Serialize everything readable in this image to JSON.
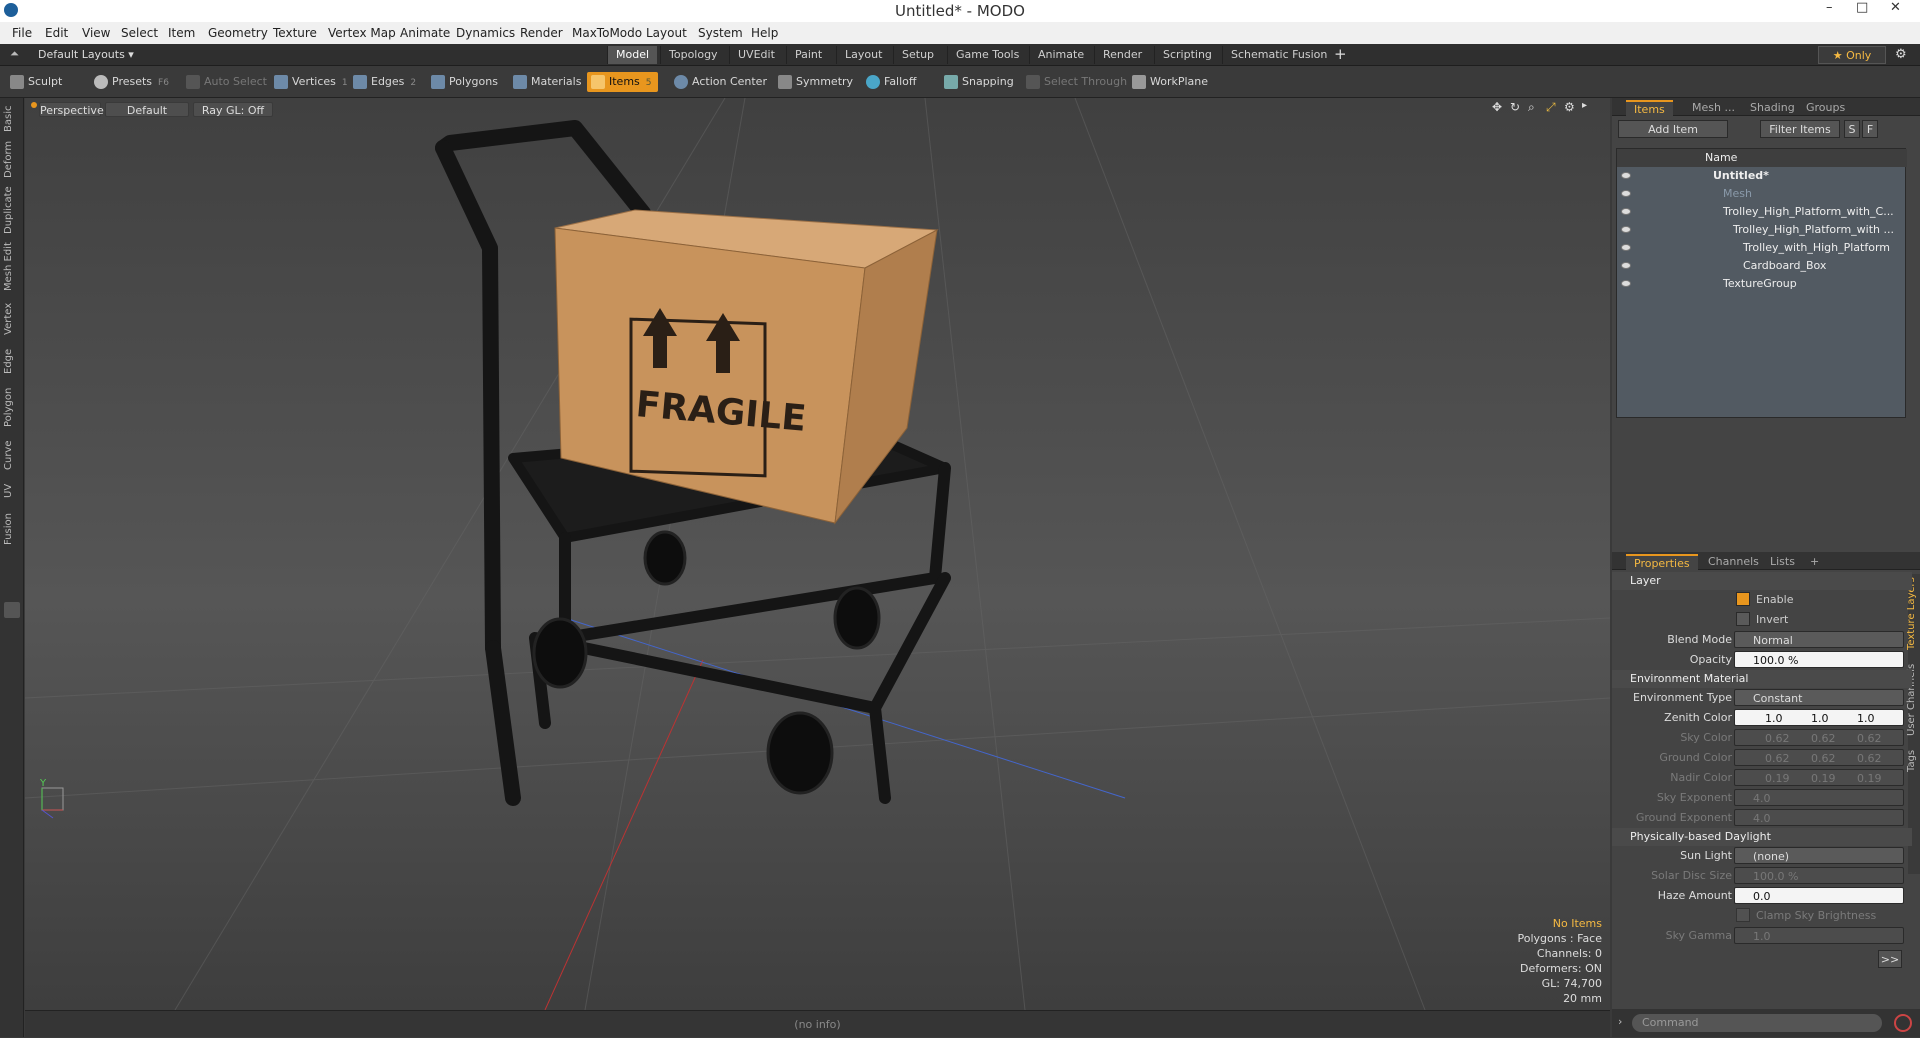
{
  "window": {
    "title": "Untitled* - MODO",
    "controls": [
      "–",
      "□",
      "✕"
    ]
  },
  "menu": [
    "File",
    "Edit",
    "View",
    "Select",
    "Item",
    "Geometry",
    "Texture",
    "Vertex Map",
    "Animate",
    "Dynamics",
    "Render",
    "MaxToModo",
    "Layout",
    "System",
    "Help"
  ],
  "layouts": {
    "label": "Default Layouts ▾",
    "tabs": [
      "Model",
      "Topology",
      "UVEdit",
      "Paint",
      "Layout",
      "Setup",
      "Game Tools",
      "Animate",
      "Render",
      "Scripting",
      "Schematic Fusion"
    ],
    "active": "Model",
    "add": "+",
    "only": "★ Only"
  },
  "toolbar": {
    "sculpt": "Sculpt",
    "presets": "Presets",
    "presets_key": "F6",
    "auto_select": "Auto Select",
    "vertices": "Vertices",
    "vertices_n": "1",
    "edges": "Edges",
    "edges_n": "2",
    "polygons": "Polygons",
    "materials": "Materials",
    "items": "Items",
    "items_n": "5",
    "action_center": "Action Center",
    "symmetry": "Symmetry",
    "falloff": "Falloff",
    "snapping": "Snapping",
    "select_through": "Select Through",
    "workplane": "WorkPlane"
  },
  "left_tabs": [
    "Basic",
    "Deform",
    "Duplicate",
    "Mesh Edit",
    "Vertex",
    "Edge",
    "Polygon",
    "Curve",
    "UV",
    "Fusion"
  ],
  "viewport": {
    "view": "Perspective",
    "shading": "Default",
    "raygl": "Ray GL: Off",
    "box_label": "FRAGILE",
    "status": {
      "no_items": "No Items",
      "polygons": "Polygons : Face",
      "channels": "Channels: 0",
      "deformers": "Deformers: ON",
      "gl": "GL: 74,700",
      "scale": "20 mm"
    },
    "axis_y": "Y",
    "info": "(no info)"
  },
  "items_panel": {
    "tabs": [
      "Items",
      "Mesh ...",
      "Shading",
      "Groups"
    ],
    "add_item": "Add Item",
    "filter": "Filter Items",
    "s": "S",
    "f": "F",
    "col_name": "Name",
    "rows": [
      {
        "name": "Untitled*",
        "bold": true,
        "indent": 0
      },
      {
        "name": "Mesh",
        "dim": true,
        "indent": 1
      },
      {
        "name": "Trolley_High_Platform_with_C...",
        "indent": 1
      },
      {
        "name": "Trolley_High_Platform_with ...",
        "indent": 2
      },
      {
        "name": "Trolley_with_High_Platform",
        "indent": 3
      },
      {
        "name": "Cardboard_Box",
        "indent": 3
      },
      {
        "name": "TextureGroup",
        "indent": 1
      }
    ]
  },
  "props_panel": {
    "tabs": [
      "Properties",
      "Channels",
      "Lists",
      "+"
    ],
    "side_tabs": [
      "Texture Layers",
      "User Channels",
      "Tags"
    ],
    "layer": "Layer",
    "enable": "Enable",
    "invert": "Invert",
    "blend_mode_label": "Blend Mode",
    "blend_mode": "Normal",
    "opacity_label": "Opacity",
    "opacity": "100.0 %",
    "env_material": "Environment Material",
    "env_type_label": "Environment Type",
    "env_type": "Constant",
    "zenith_label": "Zenith Color",
    "zenith": [
      "1.0",
      "1.0",
      "1.0"
    ],
    "sky_label": "Sky Color",
    "sky": [
      "0.62",
      "0.62",
      "0.62"
    ],
    "ground_label": "Ground Color",
    "ground": [
      "0.62",
      "0.62",
      "0.62"
    ],
    "nadir_label": "Nadir Color",
    "nadir": [
      "0.19",
      "0.19",
      "0.19"
    ],
    "sky_exp_label": "Sky Exponent",
    "sky_exp": "4.0",
    "ground_exp_label": "Ground Exponent",
    "ground_exp": "4.0",
    "daylight": "Physically-based Daylight",
    "sun_label": "Sun Light",
    "sun": "(none)",
    "solar_label": "Solar Disc Size",
    "solar": "100.0 %",
    "haze_label": "Haze Amount",
    "haze": "0.0",
    "clamp": "Clamp Sky Brightness",
    "gamma_label": "Sky Gamma",
    "gamma": "1.0",
    "more": ">>"
  },
  "command": {
    "placeholder": "Command"
  },
  "colors": {
    "accent": "#e8961e",
    "box": "#c8935c",
    "trolley": "#1a1a1a"
  }
}
